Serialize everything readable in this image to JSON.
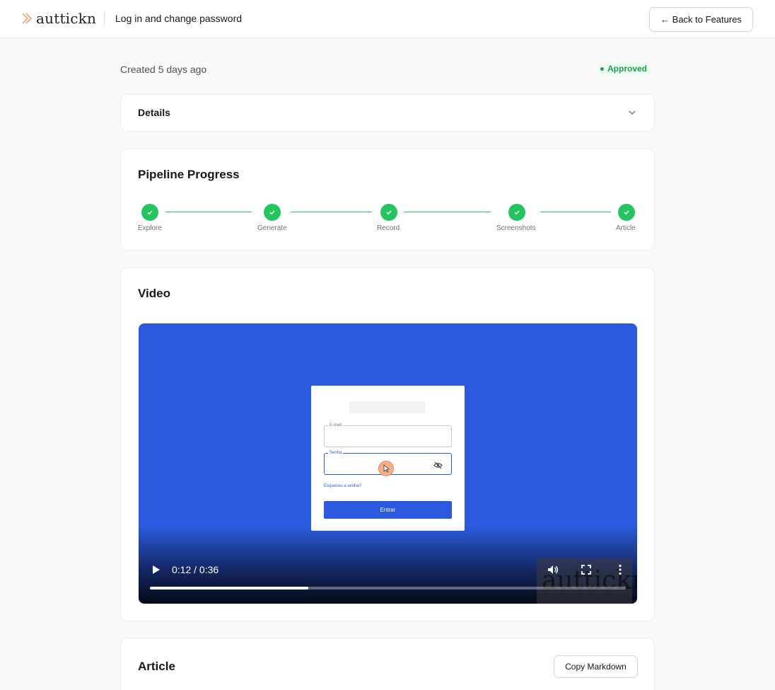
{
  "header": {
    "brand": "auttickn",
    "title": "Log in and change password",
    "back_label": "← Back to Features"
  },
  "meta": {
    "created": "Created 5 days ago",
    "status": "Approved",
    "status_color": "#16a34a"
  },
  "details": {
    "title": "Details"
  },
  "pipeline": {
    "title": "Pipeline Progress",
    "steps": [
      {
        "label": "Explore",
        "done": true
      },
      {
        "label": "Generate",
        "done": true
      },
      {
        "label": "Record",
        "done": true
      },
      {
        "label": "Screenshots",
        "done": true
      },
      {
        "label": "Article",
        "done": true
      }
    ],
    "accent": "#22c55e"
  },
  "video": {
    "title": "Video",
    "time": "0:12 / 0:36",
    "progress": 0.333,
    "watermark": "auttickn",
    "frame": {
      "email_label": "E-mail",
      "password_label": "Senha",
      "forgot": "Esqueceu a senha?",
      "submit": "Entrar"
    }
  },
  "article": {
    "title": "Article",
    "copy_label": "Copy Markdown"
  }
}
